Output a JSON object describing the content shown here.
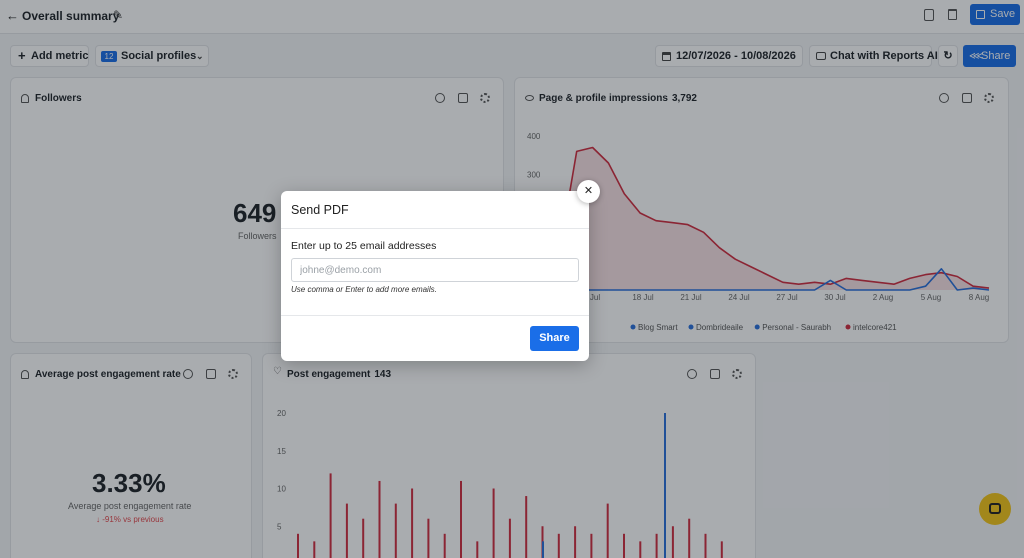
{
  "header": {
    "title": "Overall summary",
    "save_label": "Save"
  },
  "toolbar": {
    "add_metric_label": "Add metric",
    "profiles_count": "12",
    "profiles_label": "Social profiles",
    "date_range": "12/07/2026 - 10/08/2026",
    "chat_label": "Chat with Reports AI",
    "share_label": "Share"
  },
  "cards": {
    "followers": {
      "title": "Followers",
      "value": "649",
      "sub_label": "Followers"
    },
    "impressions": {
      "title": "Page & profile impressions",
      "total": "3,792"
    },
    "engagement_rate": {
      "title": "Average post engagement rate",
      "value": "3.33%",
      "sub_label": "Average post engagement rate",
      "delta": "↓ -91% vs previous"
    },
    "post_engagement": {
      "title": "Post engagement",
      "total": "143"
    }
  },
  "chart_data": [
    {
      "type": "area",
      "y_ticks": [
        "400",
        "300"
      ],
      "x_ticks": [
        "Jul",
        "18 Jul",
        "21 Jul",
        "24 Jul",
        "27 Jul",
        "30 Jul",
        "2 Aug",
        "5 Aug",
        "8 Aug"
      ],
      "legend": [
        "Blog Smart",
        "Dombrideaile",
        "Personal - Saurabh",
        "intelcore421"
      ],
      "series": [
        {
          "name": "intelcore421",
          "color": "#d12c3f",
          "values": [
            80,
            120,
            360,
            370,
            330,
            250,
            200,
            180,
            175,
            170,
            150,
            110,
            80,
            60,
            40,
            20,
            15,
            20,
            15,
            30,
            25,
            20,
            15,
            30,
            40,
            45,
            35,
            10,
            5
          ]
        },
        {
          "name": "Dombrideaile",
          "color": "#2a6fdb",
          "values": [
            0,
            0,
            0,
            0,
            0,
            0,
            0,
            0,
            0,
            0,
            0,
            0,
            0,
            0,
            0,
            0,
            0,
            0,
            25,
            0,
            0,
            0,
            0,
            0,
            10,
            55,
            0,
            5,
            0
          ]
        }
      ]
    },
    {
      "type": "bar",
      "y_ticks": [
        "20",
        "15",
        "10",
        "5"
      ],
      "series": [
        {
          "name": "red",
          "color": "#d12c3f",
          "values": [
            4,
            3,
            12,
            8,
            6,
            11,
            8,
            10,
            6,
            4,
            11,
            3,
            10,
            6,
            9,
            5,
            4,
            5,
            4,
            8,
            4,
            3,
            4,
            5,
            6,
            4,
            3
          ]
        },
        {
          "name": "blue",
          "color": "#2a6fdb",
          "values": [
            20,
            3
          ]
        }
      ]
    }
  ],
  "modal": {
    "title": "Send PDF",
    "label": "Enter up to 25 email addresses",
    "placeholder": "johne@demo.com",
    "hint": "Use comma or Enter to add more emails.",
    "share_label": "Share",
    "close_glyph": "✕"
  }
}
